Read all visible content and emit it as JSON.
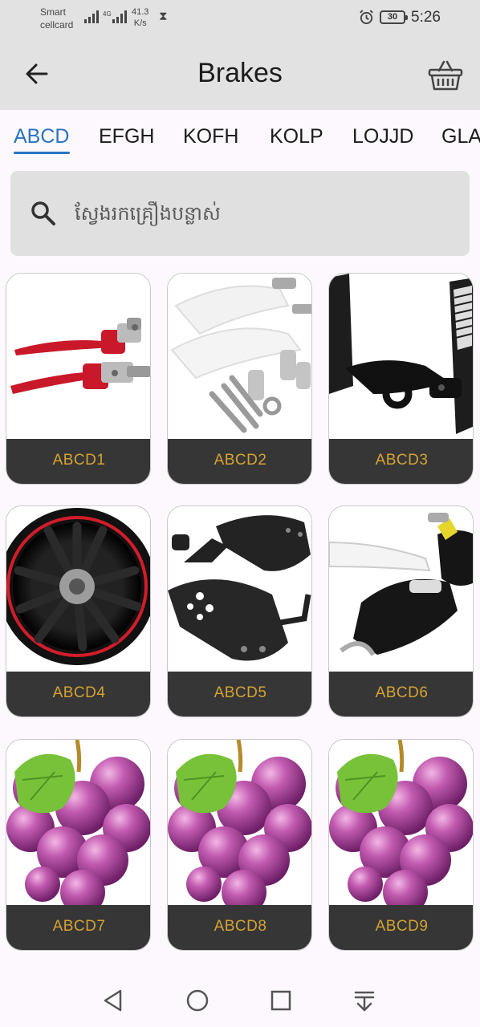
{
  "status_bar": {
    "carrier_line1": "Smart",
    "carrier_line2": "cellcard",
    "speed_value": "41.3",
    "speed_unit": "K/s",
    "battery": "30",
    "time": "5:26"
  },
  "app_bar": {
    "title": "Brakes",
    "back_icon": "arrow-left-icon",
    "cart_icon": "shopping-basket-icon"
  },
  "tabs": [
    {
      "label": "ABCD",
      "active": true
    },
    {
      "label": "EFGH",
      "active": false
    },
    {
      "label": "KOFH",
      "active": false
    },
    {
      "label": "KOLP",
      "active": false
    },
    {
      "label": "LOJJD",
      "active": false
    },
    {
      "label": "GLA",
      "active": false
    }
  ],
  "search": {
    "placeholder": "ស្វែងរកគ្រឿងបន្លាស់",
    "icon": "search-icon"
  },
  "products": [
    {
      "label": "ABCD1",
      "image": "red-brake-levers"
    },
    {
      "label": "ABCD2",
      "image": "white-handguards"
    },
    {
      "label": "ABCD3",
      "image": "black-handguard-mount"
    },
    {
      "label": "ABCD4",
      "image": "black-red-wheel"
    },
    {
      "label": "ABCD5",
      "image": "carbon-handguards"
    },
    {
      "label": "ABCD6",
      "image": "barkbusters-handguards"
    },
    {
      "label": "ABCD7",
      "image": "grapes"
    },
    {
      "label": "ABCD8",
      "image": "grapes"
    },
    {
      "label": "ABCD9",
      "image": "grapes"
    }
  ],
  "nav_bar": [
    "back-triangle-icon",
    "home-circle-icon",
    "recents-square-icon",
    "notification-pull-icon"
  ],
  "colors": {
    "accent": "#2a73c2",
    "card_footer": "#363636",
    "card_label": "#d5a233",
    "app_bar": "#e2e2e2"
  }
}
